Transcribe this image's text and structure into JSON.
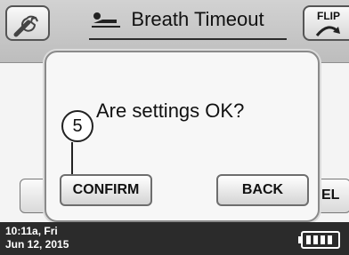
{
  "header": {
    "title": "Breath Timeout",
    "flip_label": "FLIP"
  },
  "background": {
    "right_button_fragment": "EL"
  },
  "dialog": {
    "message": "Are settings OK?",
    "callout_number": "5",
    "confirm_label": "CONFIRM",
    "back_label": "BACK"
  },
  "status_bar": {
    "time": "10:11a, Fri",
    "date": "Jun 12, 2015",
    "battery_level": 1.0
  }
}
